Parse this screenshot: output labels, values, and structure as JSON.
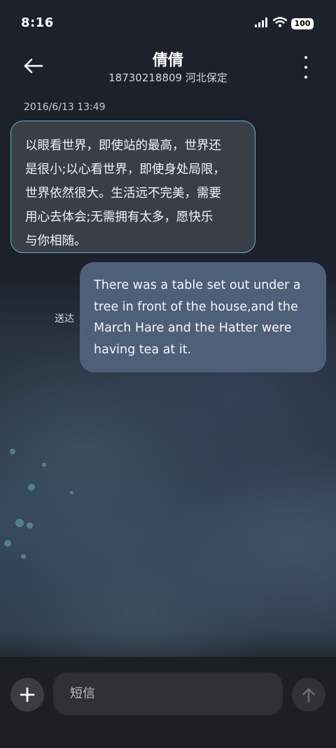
{
  "status_bar": {
    "time": "8:16",
    "battery": "100"
  },
  "header": {
    "contact_name": "倩倩",
    "contact_subtitle": "18730218809 河北保定"
  },
  "conversation": {
    "timestamp": "2016/6/13 13:49",
    "messages": [
      {
        "direction": "incoming",
        "lines": [
          "以眼看世界，即使站的最高，世界还",
          "是很小;以心看世界，即使身处局限，",
          "世界依然很大。生活远不完美，需要",
          "用心去体会;无需拥有太多，愿快乐",
          "与你相随。"
        ]
      },
      {
        "direction": "outgoing",
        "status": "送达",
        "lines": [
          "There was a table set out under a",
          "tree in front of the house,and the",
          "March Hare and the Hatter were",
          "having tea at it."
        ]
      }
    ]
  },
  "composer": {
    "placeholder": "短信"
  },
  "colors": {
    "incoming_bubble": "#3a3f47",
    "incoming_border": "#5fb0c4",
    "outgoing_bubble": "#4d6078",
    "composer_bg": "#1c1f23"
  },
  "icons": {
    "back": "arrow-left-icon",
    "more": "more-vertical-icon",
    "add": "plus-icon",
    "send": "arrow-up-icon",
    "signal": "signal-icon",
    "wifi": "wifi-icon"
  }
}
